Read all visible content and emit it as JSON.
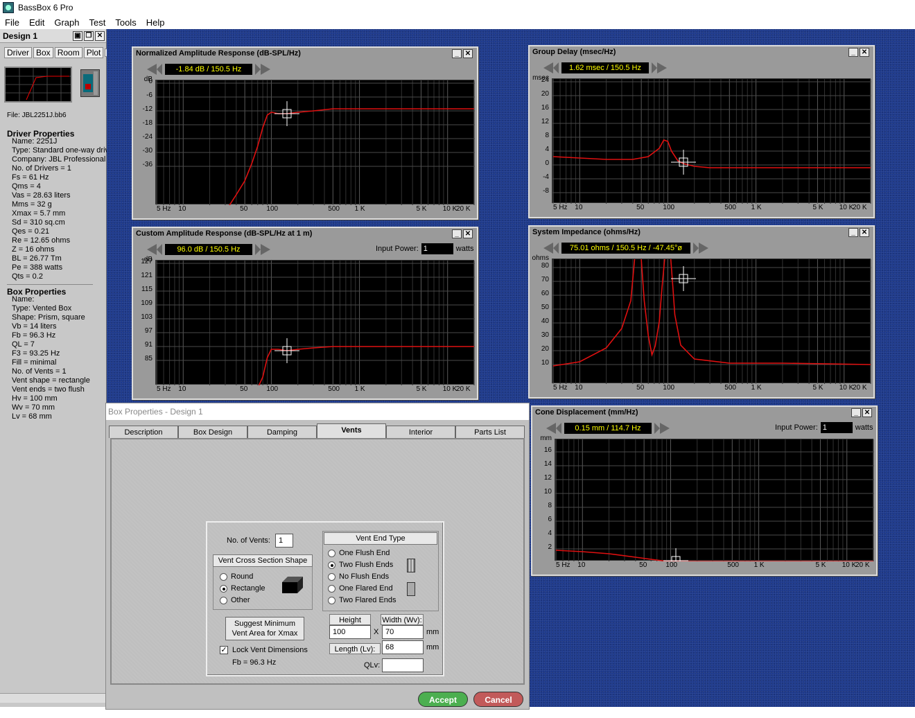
{
  "app": {
    "title": "BassBox 6 Pro"
  },
  "menu": [
    "File",
    "Edit",
    "Graph",
    "Test",
    "Tools",
    "Help"
  ],
  "sidebar": {
    "title": "Design 1",
    "tabs": [
      "Driver",
      "Box",
      "Room",
      "Plot"
    ],
    "file": "File: JBL2251J.bb6",
    "driver_heading": "Driver Properties",
    "driver": [
      "Name: 2251J",
      "Type: Standard one-way driv",
      "Company: JBL Professional [",
      "No. of Drivers = 1",
      "Fs =  61 Hz",
      "Qms =  4",
      "Vas =  28.63 liters",
      "Mms =  32 g",
      "Xmax =  5.7 mm",
      "Sd =  310 sq.cm",
      "Qes =  0.21",
      "Re =  12.65 ohms",
      "Z =  16 ohms",
      "BL =  26.77 Tm",
      "Pe =  388 watts",
      "Qts =  0.2"
    ],
    "box_heading": "Box Properties",
    "box": [
      "Name:",
      "Type: Vented Box",
      "Shape: Prism, square",
      "Vb =  14 liters",
      "Fb =  96.3 Hz",
      "QL =  7",
      "F3 =  93.25 Hz",
      "Fill = minimal",
      "No. of Vents = 1",
      "Vent shape = rectangle",
      "Vent ends = two flush",
      "Hv =  100 mm",
      "Wv =  70 mm",
      "Lv =  68 mm"
    ]
  },
  "windows": {
    "norm": {
      "title": "Normalized Amplitude Response (dB-SPL/Hz)",
      "readout": "-1.84 dB / 150.5 Hz",
      "unit": "dB",
      "yticks": [
        "0",
        "-6",
        "-12",
        "-18",
        "-24",
        "-30",
        "-36"
      ],
      "xticks": [
        "5 Hz",
        "10",
        "50",
        "100",
        "500",
        "1 K",
        "5 K",
        "10 K",
        "20 K"
      ]
    },
    "custom": {
      "title": "Custom Amplitude Response (dB-SPL/Hz at 1 m)",
      "readout": "96.0 dB / 150.5 Hz",
      "power_label": "Input Power:",
      "power": "1",
      "watts": "watts",
      "unit": "dB",
      "yticks": [
        "127",
        "121",
        "115",
        "109",
        "103",
        "97",
        "91",
        "85"
      ],
      "xticks": [
        "5 Hz",
        "10",
        "50",
        "100",
        "500",
        "1 K",
        "5 K",
        "10 K",
        "20 K"
      ]
    },
    "gd": {
      "title": "Group Delay (msec/Hz)",
      "readout": "1.62 msec / 150.5 Hz",
      "unit": "msec",
      "yticks": [
        "24",
        "20",
        "16",
        "12",
        "8",
        "4",
        "0",
        "-4",
        "-8"
      ],
      "xticks": [
        "5 Hz",
        "10",
        "50",
        "100",
        "500",
        "1 K",
        "5 K",
        "10 K",
        "20 K"
      ]
    },
    "imp": {
      "title": "System Impedance (ohms/Hz)",
      "readout": "75.01 ohms / 150.5 Hz / -47.45°ø",
      "unit": "ohms",
      "yticks": [
        "80",
        "70",
        "60",
        "50",
        "40",
        "30",
        "20",
        "10"
      ],
      "xticks": [
        "5 Hz",
        "10",
        "50",
        "100",
        "500",
        "1 K",
        "5 K",
        "10 K",
        "20 K"
      ]
    },
    "cone": {
      "title": "Cone Displacement (mm/Hz)",
      "readout": "0.15 mm / 114.7 Hz",
      "power_label": "Input Power:",
      "power": "1",
      "watts": "watts",
      "unit": "mm",
      "yticks": [
        "16",
        "14",
        "12",
        "10",
        "8",
        "6",
        "4",
        "2"
      ],
      "xticks": [
        "5 Hz",
        "10",
        "50",
        "100",
        "500",
        "1 K",
        "5 K",
        "10 K",
        "20 K"
      ]
    }
  },
  "dialog": {
    "title": "Box Properties - Design 1",
    "tabs": [
      "Description",
      "Box Design",
      "Damping",
      "Vents",
      "Interior",
      "Parts List"
    ],
    "vents_label": "No. of Vents:",
    "vents": "1",
    "shape_title": "Vent Cross Section Shape",
    "shapes": [
      "Round",
      "Rectangle",
      "Other"
    ],
    "endtype_title": "Vent End Type",
    "ends": [
      "One Flush End",
      "Two Flush Ends",
      "No Flush Ends",
      "One Flared End",
      "Two Flared Ends"
    ],
    "suggest": "Suggest Minimum Vent Area for Xmax",
    "lock": "Lock Vent Dimensions",
    "fb": "Fb = 96.3 Hz",
    "height_label": "Height (Hv):",
    "height": "100",
    "width_label": "Width (Wv):",
    "width": "70",
    "x": "X",
    "mm": "mm",
    "length_label": "Length (Lv):",
    "length": "68",
    "qlv_label": "QLv:",
    "qlv": "",
    "accept": "Accept",
    "cancel": "Cancel"
  }
}
